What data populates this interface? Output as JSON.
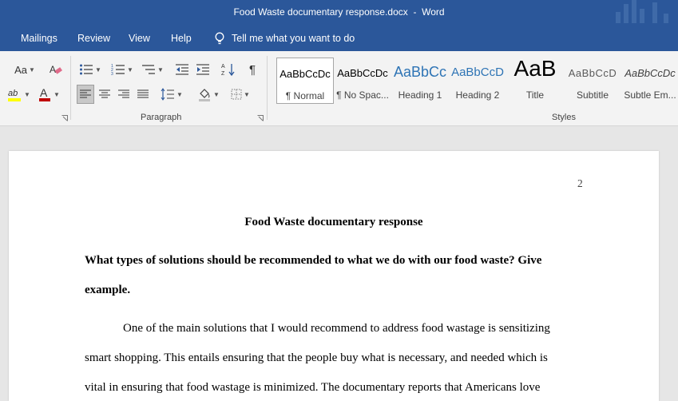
{
  "window": {
    "title": "Food Waste documentary response.docx  -  Word"
  },
  "tabs": [
    "Mailings",
    "Review",
    "View",
    "Help"
  ],
  "tell_me": "Tell me what you want to do",
  "ribbon": {
    "paragraph_label": "Paragraph",
    "styles_label": "Styles",
    "font_case_label": "Aa",
    "styles": [
      {
        "sample": "AaBbCcDc",
        "name": "¶ Normal",
        "color": "#000000"
      },
      {
        "sample": "AaBbCcDc",
        "name": "¶ No Spac...",
        "color": "#000000"
      },
      {
        "sample": "AaBbCc",
        "name": "Heading 1",
        "color": "#2e74b5"
      },
      {
        "sample": "AaBbCcD",
        "name": "Heading 2",
        "color": "#2e74b5"
      },
      {
        "sample": "AaB",
        "name": "Title",
        "color": "#000000"
      },
      {
        "sample": "AaBbCcD",
        "name": "Subtitle",
        "color": "#5a5a5a"
      },
      {
        "sample": "AaBbCcDc",
        "name": "Subtle Em...",
        "color": "#404040"
      }
    ]
  },
  "document": {
    "page_number": "2",
    "heading": "Food Waste documentary response",
    "question_lines": [
      "What types of solutions should be recommended to what we do with our food waste? Give",
      "example."
    ],
    "body_lines": [
      "One of the main solutions that I would recommend to address food wastage is sensitizing",
      "smart shopping. This entails ensuring that the people buy what is necessary, and needed which is",
      "vital in ensuring that food wastage is minimized. The documentary reports that Americans love"
    ]
  },
  "colors": {
    "accent": "#2b579a",
    "heading_blue": "#2e74b5",
    "font_red": "#c00000",
    "highlight_yellow": "#ffff00"
  }
}
